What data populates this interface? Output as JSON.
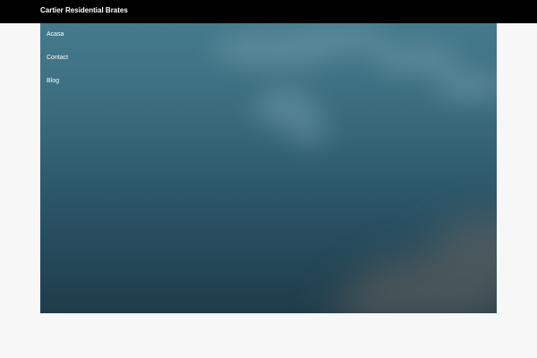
{
  "header": {
    "site_title": "Cartier Residential Brates"
  },
  "nav": {
    "items": [
      {
        "label": "Acasa"
      },
      {
        "label": "Contact"
      },
      {
        "label": "Blog"
      }
    ]
  },
  "hero": {
    "background": "sky with clouds"
  },
  "colors": {
    "topbar": "#000000",
    "page_background": "#f7f7f7",
    "hero_sky_top": "#447a8c",
    "hero_sky_bottom": "#1f3c4a",
    "text": "#ffffff"
  }
}
